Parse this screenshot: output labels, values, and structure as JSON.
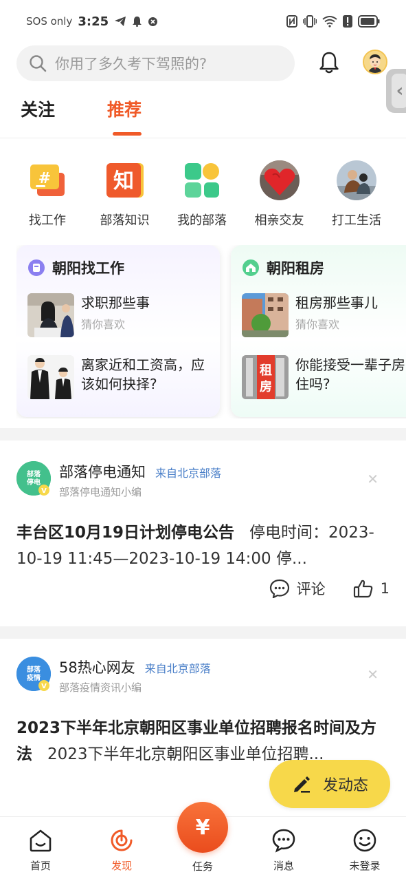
{
  "status_bar": {
    "carrier": "SOS only",
    "time": "3:25"
  },
  "search": {
    "placeholder": "你用了多久考下驾照的?"
  },
  "tabs": [
    {
      "label": "关注"
    },
    {
      "label": "推荐"
    }
  ],
  "quick_links": [
    {
      "label": "找工作",
      "icon": "job-hashtag-icon"
    },
    {
      "label": "部落知识",
      "icon": "knowledge-icon"
    },
    {
      "label": "我的部落",
      "icon": "my-tribe-grid-icon"
    },
    {
      "label": "相亲交友",
      "icon": "dating-heart-icon"
    },
    {
      "label": "打工生活",
      "icon": "work-life-photo-icon"
    }
  ],
  "topic_cards": [
    {
      "title": "朝阳找工作",
      "items": [
        {
          "title": "求职那些事",
          "subtitle": "猜你喜欢"
        },
        {
          "title": "离家近和工资高，应该如何抉择?",
          "subtitle": ""
        }
      ]
    },
    {
      "title": "朝阳租房",
      "items": [
        {
          "title": "租房那些事儿",
          "subtitle": "猜你喜欢"
        },
        {
          "title": "你能接受一辈子房子住吗?",
          "subtitle": ""
        }
      ]
    }
  ],
  "posts": [
    {
      "author": "部落停电通知",
      "source": "来自北京部落",
      "editor": "部落停电通知小编",
      "avatar_text": "部落停电通知",
      "headline": "丰台区10月19日计划停电公告",
      "body": "停电时间：2023-10-19 11:45—2023-10-19 14:00 停...",
      "comment_label": "评论",
      "likes": "1"
    },
    {
      "author": "58热心网友",
      "source": "来自北京部落",
      "editor": "部落疫情资讯小编",
      "avatar_text": "部落疫情资讯",
      "headline": "2023下半年北京朝阳区事业单位招聘报名时间及方法",
      "body": "2023下半年北京朝阳区事业单位招聘..."
    }
  ],
  "fab": {
    "label": "发动态"
  },
  "bottom_nav": [
    {
      "label": "首页"
    },
    {
      "label": "发现"
    },
    {
      "label": "任务",
      "symbol": "¥"
    },
    {
      "label": "消息"
    },
    {
      "label": "未登录"
    }
  ],
  "colors": {
    "accent": "#f05a28",
    "fab": "#f7d84a",
    "link": "#4a7fc8"
  }
}
